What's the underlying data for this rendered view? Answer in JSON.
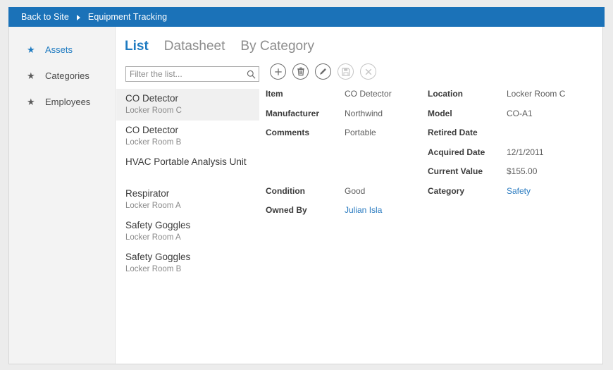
{
  "breadcrumb": {
    "back_label": "Back to Site",
    "separator_icon": "chevron-right-icon",
    "current": "Equipment Tracking"
  },
  "sidebar": {
    "items": [
      {
        "label": "Assets",
        "icon": "star-icon",
        "active": true
      },
      {
        "label": "Categories",
        "icon": "star-icon",
        "active": false
      },
      {
        "label": "Employees",
        "icon": "star-icon",
        "active": false
      }
    ]
  },
  "tabs": [
    {
      "label": "List",
      "active": true
    },
    {
      "label": "Datasheet",
      "active": false
    },
    {
      "label": "By Category",
      "active": false
    }
  ],
  "filter": {
    "value": "",
    "placeholder": "Filter the list...",
    "icon": "search-icon"
  },
  "toolbar": {
    "buttons": [
      {
        "name": "add-button",
        "icon": "plus-icon",
        "enabled": true
      },
      {
        "name": "delete-button",
        "icon": "trash-icon",
        "enabled": true
      },
      {
        "name": "edit-button",
        "icon": "pencil-icon",
        "enabled": true
      },
      {
        "name": "save-button",
        "icon": "floppy-disk-icon",
        "enabled": false
      },
      {
        "name": "cancel-button",
        "icon": "close-x-icon",
        "enabled": false
      }
    ]
  },
  "list": {
    "items": [
      {
        "title": "CO Detector",
        "subtitle": "Locker Room C",
        "selected": true
      },
      {
        "title": "CO Detector",
        "subtitle": "Locker Room B",
        "selected": false
      },
      {
        "title": "HVAC Portable Analysis Unit",
        "subtitle": "",
        "selected": false
      },
      {
        "title": "Respirator",
        "subtitle": "Locker Room A",
        "selected": false
      },
      {
        "title": "Safety Goggles",
        "subtitle": "Locker Room A",
        "selected": false
      },
      {
        "title": "Safety Goggles",
        "subtitle": "Locker Room B",
        "selected": false
      }
    ]
  },
  "detail": {
    "left": [
      {
        "label": "Item",
        "value": "CO Detector",
        "link": false
      },
      {
        "label": "Manufacturer",
        "value": "Northwind",
        "link": false
      },
      {
        "label": "Comments",
        "value": "Portable",
        "link": false
      },
      {
        "label": "",
        "value": "",
        "link": false
      },
      {
        "label": "",
        "value": "",
        "link": false
      },
      {
        "label": "Condition",
        "value": "Good",
        "link": false
      },
      {
        "label": "Owned By",
        "value": "Julian Isla",
        "link": true
      }
    ],
    "right": [
      {
        "label": "Location",
        "value": "Locker Room C",
        "link": false
      },
      {
        "label": "Model",
        "value": "CO-A1",
        "link": false
      },
      {
        "label": "Retired Date",
        "value": "",
        "link": false
      },
      {
        "label": "Acquired Date",
        "value": "12/1/2011",
        "link": false
      },
      {
        "label": "Current Value",
        "value": "$155.00",
        "link": false
      },
      {
        "label": "Category",
        "value": "Safety",
        "link": true
      }
    ]
  },
  "colors": {
    "header_blue": "#1b72b8",
    "accent_blue": "#1f7bc1",
    "link_blue": "#2a7bc0",
    "selected_row": "#f0f0f0",
    "sidebar_bg": "#f3f3f3",
    "page_bg": "#ececec"
  }
}
